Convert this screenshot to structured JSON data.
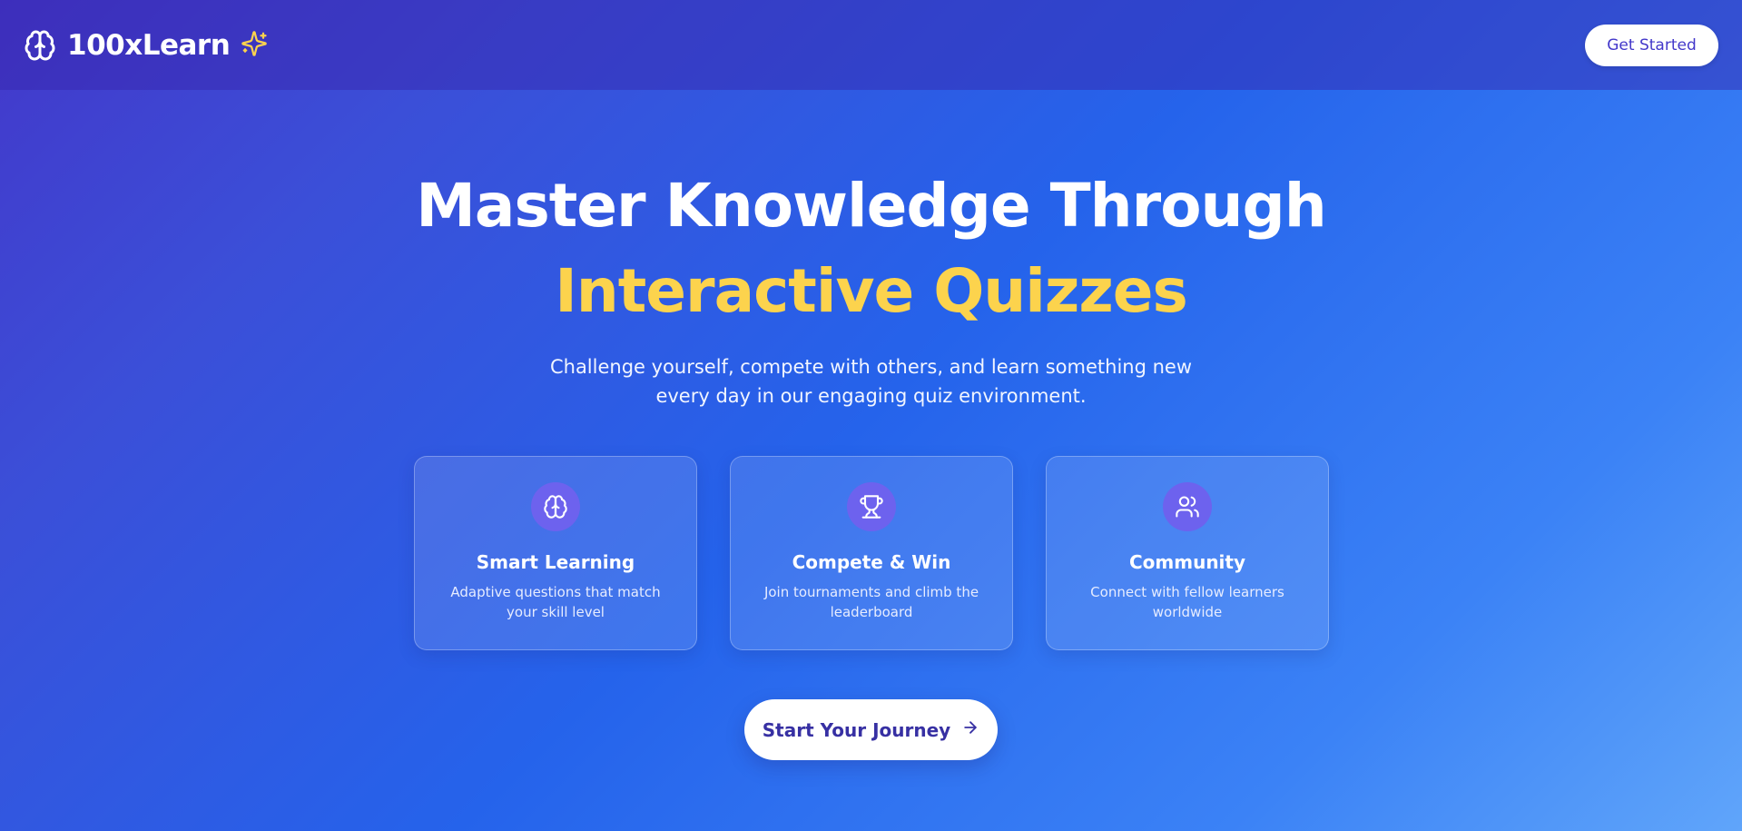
{
  "nav": {
    "brand_name": "100xLearn",
    "brand_icon": "brain-icon",
    "brand_accent_icon": "sparkles-icon",
    "get_started_label": "Get Started"
  },
  "hero": {
    "title_line1": "Master Knowledge Through",
    "title_line2": "Interactive Quizzes",
    "subtitle": "Challenge yourself, compete with others, and learn something new every day in our engaging quiz environment."
  },
  "features": [
    {
      "icon": "brain-icon",
      "title": "Smart Learning",
      "description": "Adaptive questions that match your skill level"
    },
    {
      "icon": "trophy-icon",
      "title": "Compete & Win",
      "description": "Join tournaments and climb the leaderboard"
    },
    {
      "icon": "users-icon",
      "title": "Community",
      "description": "Connect with fellow learners worldwide"
    }
  ],
  "cta": {
    "label": "Start Your Journey",
    "icon": "arrow-right-icon"
  },
  "colors": {
    "accent_yellow": "#fcd34d",
    "button_text": "#4338ca",
    "icon_circle": "#6d62ee",
    "gradient_start": "#4338ca",
    "gradient_end": "#60a5fa"
  }
}
